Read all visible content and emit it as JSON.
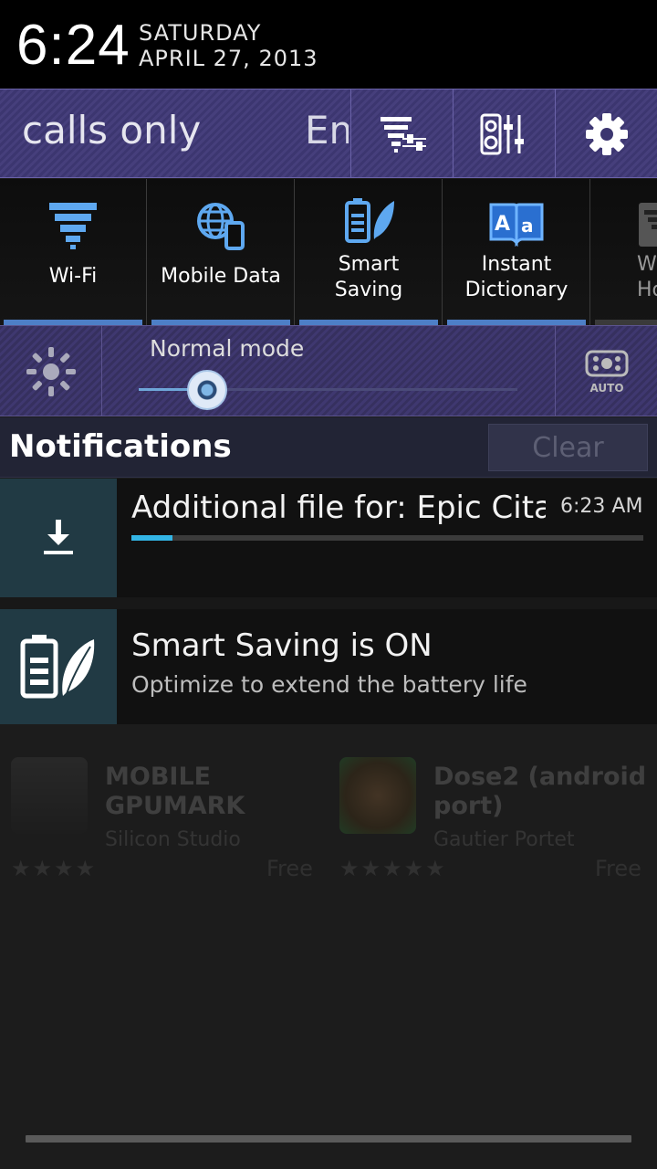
{
  "status": {
    "time": "6:24",
    "day": "SATURDAY",
    "date": "APRIL 27, 2013"
  },
  "operator": {
    "text": "calls only",
    "text2": "Em",
    "buttons": [
      "wifi-settings-icon",
      "sound-equalizer-icon",
      "gear-icon"
    ]
  },
  "toggles": [
    {
      "label": "Wi-Fi",
      "icon": "wifi-icon",
      "on": true
    },
    {
      "label": "Mobile Data",
      "icon": "mobile-data-icon",
      "on": true
    },
    {
      "label": "Smart\nSaving",
      "icon": "smart-saving-icon",
      "on": true
    },
    {
      "label": "Instant\nDictionary",
      "icon": "dictionary-icon",
      "on": true
    },
    {
      "label": "Wi\nHot",
      "icon": "hotspot-icon",
      "on": false
    }
  ],
  "brightness": {
    "mode": "Normal mode",
    "level": 0.18,
    "auto_label": "AUTO"
  },
  "notifications": {
    "title": "Notifications",
    "clear_label": "Clear",
    "items": [
      {
        "title": "Additional file for: Epic Citadel",
        "time": "6:23 AM",
        "progress": 0.08,
        "icon": "download-icon"
      },
      {
        "title": "Smart Saving is ON",
        "subtitle": "Optimize to extend the battery life",
        "icon": "battery-leaf-icon"
      }
    ]
  },
  "background_apps": [
    {
      "title": "MOBILE\nGPUMARK",
      "publisher": "Silicon Studio",
      "price": "Free"
    },
    {
      "title": "Dose2 (android\nport)",
      "publisher": "Gautier Portet",
      "price": "Free"
    }
  ],
  "colors": {
    "accent": "#33b5e5",
    "toggle_indicator": "#4d7fc7",
    "icon_box": "#213a44"
  }
}
